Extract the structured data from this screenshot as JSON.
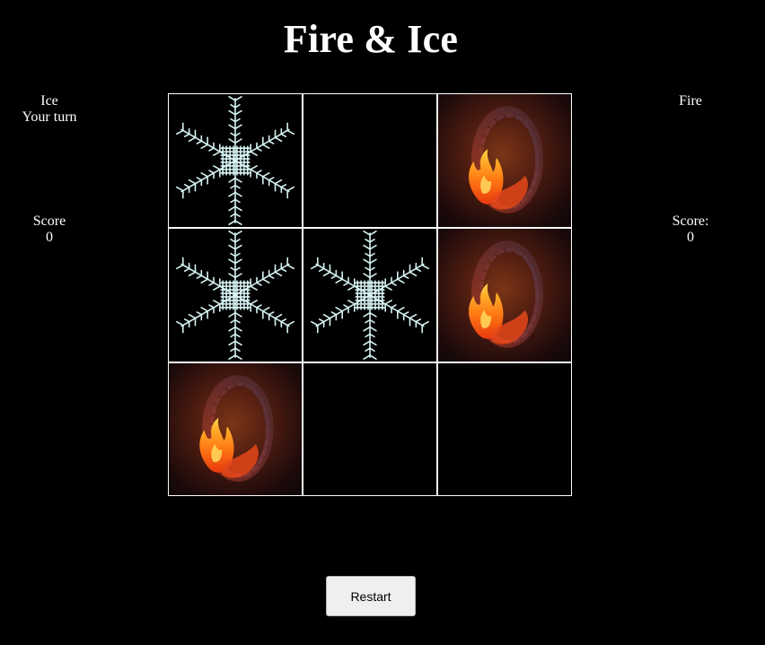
{
  "title": "Fire & Ice",
  "ice_panel": {
    "name": "Ice",
    "status": "Your turn",
    "score_label": "Score",
    "score_value": "0"
  },
  "fire_panel": {
    "name": "Fire",
    "status": "",
    "score_label": "Score:",
    "score_value": "0"
  },
  "board": [
    [
      "ice",
      "empty",
      "fire"
    ],
    [
      "ice",
      "ice",
      "fire"
    ],
    [
      "fire",
      "empty",
      "empty"
    ]
  ],
  "piece_icons": {
    "ice": "snowflake-icon",
    "fire": "fire-ring-icon"
  },
  "colors": {
    "background": "#000000",
    "grid_line": "#ffffff",
    "snowflake": "#d8f4f4",
    "fire_glow": "#7a2a14",
    "flame": "#ff8a1a"
  },
  "restart_label": "Restart"
}
